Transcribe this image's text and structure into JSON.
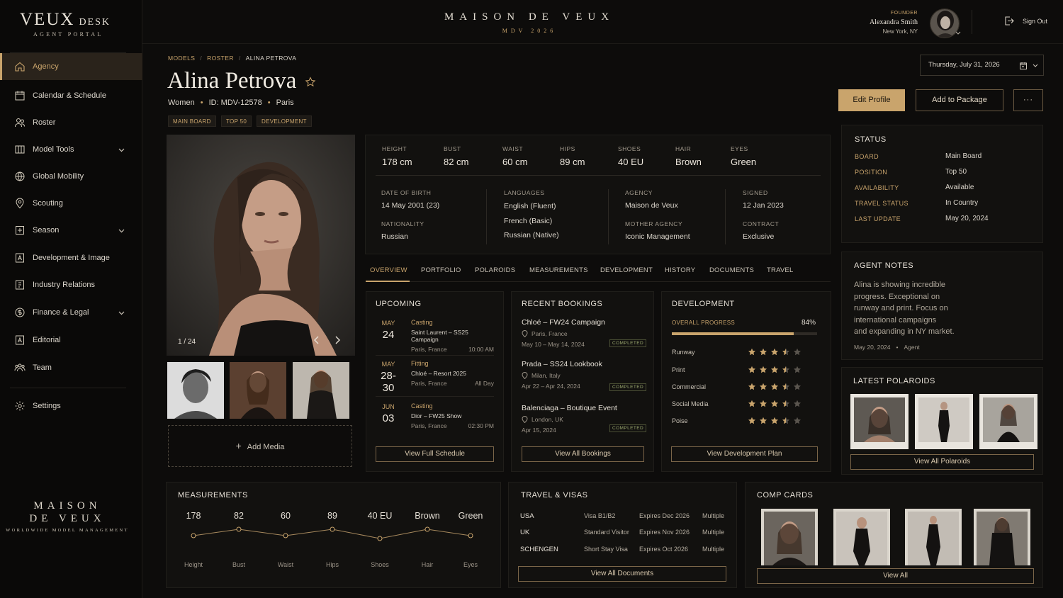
{
  "brand": {
    "logo_main": "VEUX",
    "logo_side": "DESK",
    "logo_sub": "AGENT PORTAL",
    "center_title": "MAISON DE VEUX",
    "center_sub": "MDV 2026",
    "footer_a": "MAISON",
    "footer_b": "DE VEUX",
    "footer_c": "WORLDWIDE MODEL MANAGEMENT"
  },
  "user": {
    "role": "FOUNDER",
    "name": "Alexandra Smith",
    "location": "New York, NY",
    "signout": "Sign Out"
  },
  "sidebar": {
    "items": [
      {
        "label": "Agency",
        "icon": "home-icon"
      },
      {
        "label": "Calendar & Schedule",
        "icon": "calendar-icon"
      },
      {
        "label": "Roster",
        "icon": "people-icon"
      },
      {
        "label": "Model Tools",
        "icon": "columns-icon"
      },
      {
        "label": "Global Mobility",
        "icon": "globe-icon"
      },
      {
        "label": "Scouting",
        "icon": "pin-icon"
      },
      {
        "label": "Season",
        "icon": "season-icon"
      },
      {
        "label": "Development & Image",
        "icon": "id-card-icon"
      },
      {
        "label": "Industry Relations",
        "icon": "contract-icon"
      },
      {
        "label": "Finance & Legal",
        "icon": "coin-icon"
      },
      {
        "label": "Editorial",
        "icon": "editorial-icon"
      },
      {
        "label": "Team",
        "icon": "team-icon"
      },
      {
        "label": "Settings",
        "icon": "gear-icon"
      }
    ]
  },
  "breadcrumb": [
    "MODELS",
    "ROSTER",
    "ALINA PETROVA"
  ],
  "model": {
    "name": "Alina Petrova",
    "division": "Women",
    "id": "ID: MDV-12578",
    "city": "Paris",
    "tags": [
      "MAIN BOARD",
      "TOP 50",
      "DEVELOPMENT"
    ],
    "photo_counter": "1 / 24",
    "add_media": "Add Media"
  },
  "date": "Thursday, July 31, 2026",
  "actions": {
    "edit": "Edit Profile",
    "add": "Add to Package",
    "more": "···"
  },
  "stats": [
    {
      "label": "HEIGHT",
      "value": "178 cm"
    },
    {
      "label": "BUST",
      "value": "82 cm"
    },
    {
      "label": "WAIST",
      "value": "60 cm"
    },
    {
      "label": "HIPS",
      "value": "89 cm"
    },
    {
      "label": "SHOES",
      "value": "40 EU"
    },
    {
      "label": "HAIR",
      "value": "Brown"
    },
    {
      "label": "EYES",
      "value": "Green"
    }
  ],
  "details": {
    "dob_label": "DATE OF BIRTH",
    "dob": "14 May 2001 (23)",
    "nat_label": "NATIONALITY",
    "nat": "Russian",
    "lang_label": "LANGUAGES",
    "langs": [
      "English (Fluent)",
      "French (Basic)",
      "Russian (Native)"
    ],
    "agency_label": "AGENCY",
    "agency": "Maison de Veux",
    "mother_label": "MOTHER AGENCY",
    "mother": "Iconic Management",
    "signed_label": "SIGNED",
    "signed": "12 Jan 2023",
    "contract_label": "CONTRACT",
    "contract": "Exclusive"
  },
  "tabs": [
    "OVERVIEW",
    "PORTFOLIO",
    "POLAROIDS",
    "MEASUREMENTS",
    "DEVELOPMENT",
    "HISTORY",
    "DOCUMENTS",
    "TRAVEL"
  ],
  "upcoming": {
    "title": "UPCOMING",
    "button": "View Full Schedule",
    "items": [
      {
        "month": "MAY",
        "day": "24",
        "type": "Casting",
        "title": "Saint Laurent – SS25 Campaign",
        "place": "Paris, France",
        "time": "10:00 AM"
      },
      {
        "month": "MAY",
        "day": "28-30",
        "type": "Fitting",
        "title": "Chloé – Resort 2025",
        "place": "Paris, France",
        "time": "All Day"
      },
      {
        "month": "JUN",
        "day": "03",
        "type": "Casting",
        "title": "Dior – FW25 Show",
        "place": "Paris, France",
        "time": "02:30 PM"
      }
    ]
  },
  "bookings": {
    "title": "RECENT BOOKINGS",
    "button": "View All Bookings",
    "items": [
      {
        "title": "Chloé – FW24 Campaign",
        "place": "Paris, France",
        "dates": "May 10 – May 14, 2024",
        "status": "COMPLETED"
      },
      {
        "title": "Prada – SS24 Lookbook",
        "place": "Milan, Italy",
        "dates": "Apr 22 – Apr 24, 2024",
        "status": "COMPLETED"
      },
      {
        "title": "Balenciaga – Boutique Event",
        "place": "London, UK",
        "dates": "Apr 15, 2024",
        "status": "COMPLETED"
      }
    ]
  },
  "development": {
    "title": "DEVELOPMENT",
    "progress_label": "OVERALL PROGRESS",
    "progress_text": "84%",
    "progress": 0.84,
    "button": "View Development Plan",
    "ratings": [
      {
        "label": "Runway",
        "stars": 3.5
      },
      {
        "label": "Print",
        "stars": 3.5
      },
      {
        "label": "Commercial",
        "stars": 3.5
      },
      {
        "label": "Social Media",
        "stars": 3.5
      },
      {
        "label": "Poise",
        "stars": 3.5
      }
    ]
  },
  "status": {
    "title": "STATUS",
    "rows": [
      {
        "k": "BOARD",
        "v": "Main Board"
      },
      {
        "k": "POSITION",
        "v": "Top 50"
      },
      {
        "k": "AVAILABILITY",
        "v": "Available"
      },
      {
        "k": "TRAVEL STATUS",
        "v": "In Country"
      },
      {
        "k": "LAST UPDATE",
        "v": "May 20, 2024"
      }
    ]
  },
  "notes": {
    "title": "AGENT NOTES",
    "lines": [
      "Alina is showing incredible",
      "progress. Exceptional on",
      "runway and print. Focus on",
      "international campaigns",
      "and expanding in NY market."
    ],
    "date": "May 20, 2024",
    "author": "Agent"
  },
  "polaroids": {
    "title": "LATEST POLAROIDS",
    "button": "View All Polaroids"
  },
  "measurements": {
    "title": "MEASUREMENTS",
    "values": [
      "178",
      "82",
      "60",
      "89",
      "40 EU",
      "Brown",
      "Green"
    ],
    "labels": [
      "Height",
      "Bust",
      "Waist",
      "Hips",
      "Shoes",
      "Hair",
      "Eyes"
    ]
  },
  "travel": {
    "title": "TRAVEL & VISAS",
    "button": "View All Documents",
    "rows": [
      {
        "country": "USA",
        "visa": "Visa B1/B2",
        "exp": "Expires Dec 2026",
        "entry": "Multiple"
      },
      {
        "country": "UK",
        "visa": "Standard Visitor",
        "exp": "Expires Nov 2026",
        "entry": "Multiple"
      },
      {
        "country": "SCHENGEN",
        "visa": "Short Stay Visa",
        "exp": "Expires Oct 2026",
        "entry": "Multiple"
      }
    ]
  },
  "comp": {
    "title": "COMP CARDS",
    "button": "View All"
  },
  "colors": {
    "accent": "#c9a46c",
    "bg": "#0d0c0b",
    "panel": "#12110f",
    "complete": "#9aa76f"
  }
}
